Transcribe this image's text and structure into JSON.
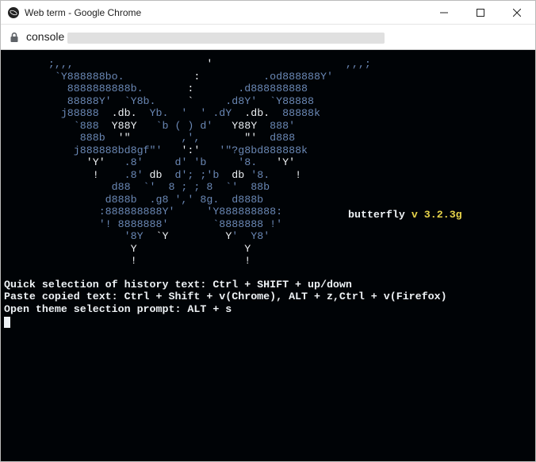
{
  "window": {
    "title": "Web term - Google Chrome",
    "minimize_label": "Minimize",
    "maximize_label": "Maximize",
    "close_label": "Close"
  },
  "address": {
    "host": "console"
  },
  "branding": {
    "name": "butterfly",
    "version_prefix": "v",
    "version": "3.2.3g"
  },
  "ascii_art": [
    {
      "pre": " ;,,,                     ",
      "w": "'",
      "post": "                     ,,,;"
    },
    {
      "pre": "  `Y888888bo.           ",
      "w": ":",
      "post": "          .od888888Y'"
    },
    {
      "pre": "    8888888888b.       ",
      "w": ":",
      "post": "       .d888888888"
    },
    {
      "pre": "    88888Y'  `Y8b.     ",
      "w": "`",
      "post": "     .d8Y'  `Y88888"
    },
    {
      "pre": "   j88888  ",
      "w": ".db.",
      "post": "  Yb.  '  ' .dY  ",
      "w2": ".db.",
      "post2": "  88888k"
    },
    {
      "pre": "     `888  ",
      "w": "Y88Y",
      "post": "   `b ( ) d'   ",
      "w2": "Y88Y",
      "post2": "  888'"
    },
    {
      "pre": "      888b  ",
      "w": "'\"",
      "post": "        ,',       ",
      "w2": "\"'",
      "post2": "  d888"
    },
    {
      "pre": "     j888888bd8gf\"'   ",
      "w": "':'",
      "post": "   '\"?g8bd888888k"
    },
    {
      "pre": "       ",
      "w": "'Y'",
      "post": "   .8'     d' 'b     '8.   ",
      "w2": "'Y'",
      "post2": ""
    },
    {
      "pre": "        ",
      "w": "!",
      "post": "    .8' ",
      "w2": "db",
      "post2": "  d'; ;'b  ",
      "w3": "db",
      "post3": " '8.    ",
      "w4": "!",
      "post4": ""
    },
    {
      "pre": "           d88  `'  8 ; ; 8  `'  88b",
      "w": "",
      "post": ""
    },
    {
      "pre": "          d888b  .g8 ',' 8g.  d888b",
      "w": "",
      "post": ""
    },
    {
      "pre": "         :888888888Y'     'Y888888888:",
      "w": "",
      "post": ""
    },
    {
      "pre": "         '! 8888888'       `8888888 !'",
      "w": "",
      "post": ""
    },
    {
      "pre": "             '8Y  ",
      "w": "`Y",
      "post": "         ",
      "w2": "Y",
      "post2": "'  Y8'"
    },
    {
      "pre": "              ",
      "w": "Y",
      "post": "                 ",
      "w2": "Y",
      "post2": ""
    },
    {
      "pre": "              ",
      "w": "!",
      "post": "                 ",
      "w2": "!",
      "post2": ""
    }
  ],
  "help_lines": [
    "Quick selection of history text: Ctrl + SHIFT + up/down",
    "Paste copied text: Ctrl + Shift + v(Chrome), ALT + z,Ctrl + v(Firefox)",
    "Open theme selection prompt: ALT + s"
  ]
}
